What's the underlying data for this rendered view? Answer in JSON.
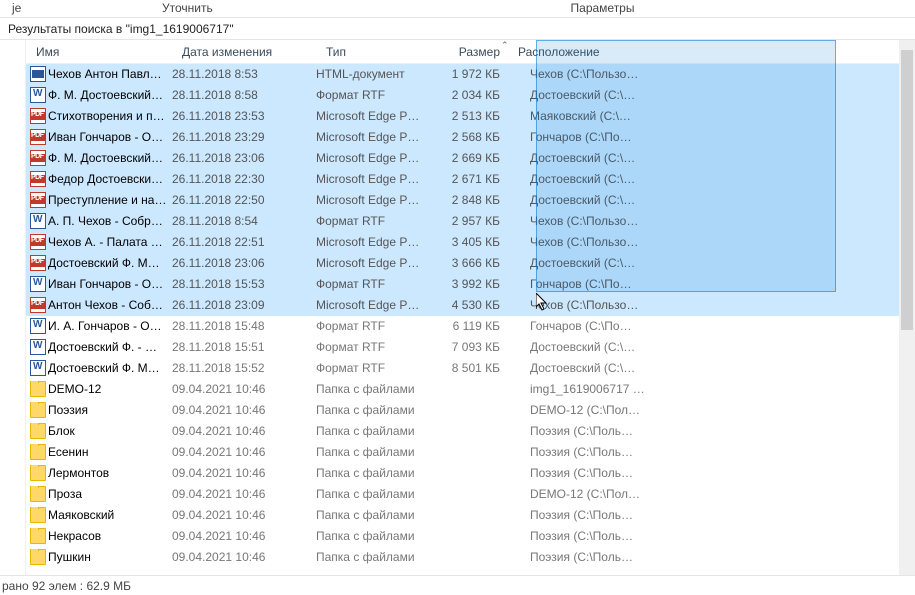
{
  "ribbon": {
    "tab1": "је",
    "tab2": "Уточнить",
    "tab3": "Параметры"
  },
  "breadcrumb": "Результаты поиска в \"img1_1619006717\"",
  "columns": {
    "name": "Имя",
    "date": "Дата изменения",
    "type": "Тип",
    "size": "Размер",
    "location": "Расположение",
    "sort_indicator": "⌃"
  },
  "rows": [
    {
      "icon": "html",
      "sel": true,
      "name": "Чехов Антон Павл…",
      "date": "28.11.2018 8:53",
      "type": "HTML-документ",
      "size": "1 972 КБ",
      "loc": "Чехов (C:\\Пользо…"
    },
    {
      "icon": "rtf",
      "sel": true,
      "name": "Ф. М. Достоевский…",
      "date": "28.11.2018 8:58",
      "type": "Формат RTF",
      "size": "2 034 КБ",
      "loc": "Достоевский (C:\\…"
    },
    {
      "icon": "pdf",
      "sel": true,
      "name": "Стихотворения и п…",
      "date": "26.11.2018 23:53",
      "type": "Microsoft Edge P…",
      "size": "2 513 КБ",
      "loc": "Маяковский (C:\\…"
    },
    {
      "icon": "pdf",
      "sel": true,
      "name": "Иван Гончаров - О…",
      "date": "26.11.2018 23:29",
      "type": "Microsoft Edge P…",
      "size": "2 568 КБ",
      "loc": "Гончаров (C:\\По…"
    },
    {
      "icon": "pdf",
      "sel": true,
      "name": "Ф. М. Достоевский…",
      "date": "26.11.2018 23:06",
      "type": "Microsoft Edge P…",
      "size": "2 669 КБ",
      "loc": "Достоевский (C:\\…"
    },
    {
      "icon": "pdf",
      "sel": true,
      "name": "Федор Достоевски…",
      "date": "26.11.2018 22:30",
      "type": "Microsoft Edge P…",
      "size": "2 671 КБ",
      "loc": "Достоевский (C:\\…"
    },
    {
      "icon": "pdf",
      "sel": true,
      "name": "Преступление и на…",
      "date": "26.11.2018 22:50",
      "type": "Microsoft Edge P…",
      "size": "2 848 КБ",
      "loc": "Достоевский (C:\\…"
    },
    {
      "icon": "rtf",
      "sel": true,
      "name": "А. П. Чехов - Собр…",
      "date": "28.11.2018 8:54",
      "type": "Формат RTF",
      "size": "2 957 КБ",
      "loc": "Чехов (C:\\Пользо…"
    },
    {
      "icon": "pdf",
      "sel": true,
      "name": "Чехов А. - Палата …",
      "date": "26.11.2018 22:51",
      "type": "Microsoft Edge P…",
      "size": "3 405 КБ",
      "loc": "Чехов (C:\\Пользо…"
    },
    {
      "icon": "pdf",
      "sel": true,
      "name": "Достоевский Ф. М…",
      "date": "26.11.2018 23:06",
      "type": "Microsoft Edge P…",
      "size": "3 666 КБ",
      "loc": "Достоевский (C:\\…"
    },
    {
      "icon": "rtf",
      "sel": true,
      "name": "Иван Гончаров - О…",
      "date": "28.11.2018 15:53",
      "type": "Формат RTF",
      "size": "3 992 КБ",
      "loc": "Гончаров (C:\\По…"
    },
    {
      "icon": "pdf",
      "sel": true,
      "name": "Антон Чехов - Соб…",
      "date": "26.11.2018 23:09",
      "type": "Microsoft Edge P…",
      "size": "4 530 КБ",
      "loc": "Чехов (C:\\Пользо…"
    },
    {
      "icon": "rtf",
      "sel": false,
      "name": "И. А. Гончаров - О…",
      "date": "28.11.2018 15:48",
      "type": "Формат RTF",
      "size": "6 119 КБ",
      "loc": "Гончаров (C:\\По…"
    },
    {
      "icon": "rtf",
      "sel": false,
      "name": "Достоевский Ф. - …",
      "date": "28.11.2018 15:51",
      "type": "Формат RTF",
      "size": "7 093 КБ",
      "loc": "Достоевский (C:\\…"
    },
    {
      "icon": "rtf",
      "sel": false,
      "name": "Достоевский Ф. М…",
      "date": "28.11.2018 15:52",
      "type": "Формат RTF",
      "size": "8 501 КБ",
      "loc": "Достоевский (C:\\…"
    },
    {
      "icon": "folder",
      "sel": false,
      "name": "DEMO-12",
      "date": "09.04.2021 10:46",
      "type": "Папка с файлами",
      "size": "",
      "loc": "img1_1619006717 …"
    },
    {
      "icon": "folder",
      "sel": false,
      "name": "Поэзия",
      "date": "09.04.2021 10:46",
      "type": "Папка с файлами",
      "size": "",
      "loc": "DEMO-12 (C:\\Пол…"
    },
    {
      "icon": "folder",
      "sel": false,
      "name": "Блок",
      "date": "09.04.2021 10:46",
      "type": "Папка с файлами",
      "size": "",
      "loc": "Поэзия (C:\\Поль…"
    },
    {
      "icon": "folder",
      "sel": false,
      "name": "Есенин",
      "date": "09.04.2021 10:46",
      "type": "Папка с файлами",
      "size": "",
      "loc": "Поэзия (C:\\Поль…"
    },
    {
      "icon": "folder",
      "sel": false,
      "name": "Лермонтов",
      "date": "09.04.2021 10:46",
      "type": "Папка с файлами",
      "size": "",
      "loc": "Поэзия (C:\\Поль…"
    },
    {
      "icon": "folder",
      "sel": false,
      "name": "Проза",
      "date": "09.04.2021 10:46",
      "type": "Папка с файлами",
      "size": "",
      "loc": "DEMO-12 (C:\\Пол…"
    },
    {
      "icon": "folder",
      "sel": false,
      "name": "Маяковский",
      "date": "09.04.2021 10:46",
      "type": "Папка с файлами",
      "size": "",
      "loc": "Поэзия (C:\\Поль…"
    },
    {
      "icon": "folder",
      "sel": false,
      "name": "Некрасов",
      "date": "09.04.2021 10:46",
      "type": "Папка с файлами",
      "size": "",
      "loc": "Поэзия (C:\\Поль…"
    },
    {
      "icon": "folder",
      "sel": false,
      "name": "Пушкин",
      "date": "09.04.2021 10:46",
      "type": "Папка с файлами",
      "size": "",
      "loc": "Поэзия (C:\\Поль…"
    }
  ],
  "status": "рано 92 элем : 62.9 МБ"
}
